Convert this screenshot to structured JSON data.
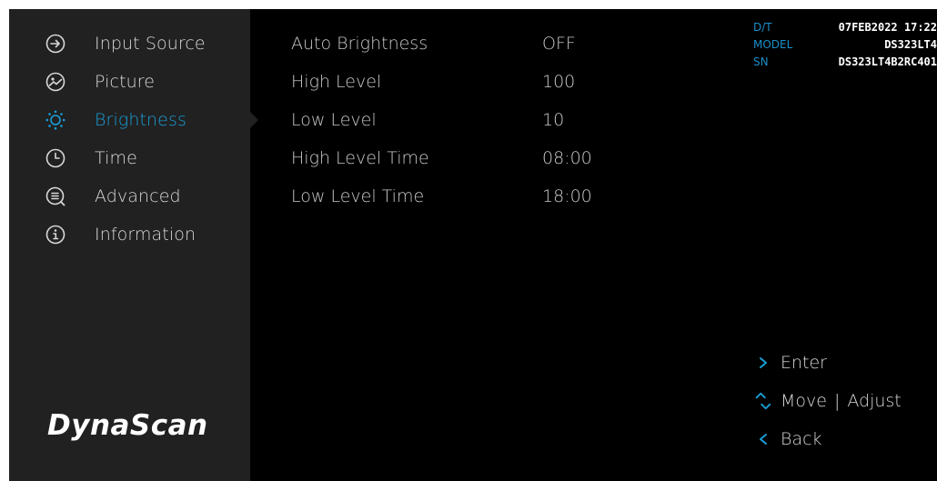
{
  "colors": {
    "accent": "#1a9fd8",
    "sidebar_bg": "#212121",
    "screen_bg": "#000000",
    "text": "#d8d8d8"
  },
  "sidebar": {
    "items": [
      {
        "label": "Input Source",
        "icon": "input-source-icon",
        "active": false
      },
      {
        "label": "Picture",
        "icon": "picture-icon",
        "active": false
      },
      {
        "label": "Brightness",
        "icon": "brightness-icon",
        "active": true
      },
      {
        "label": "Time",
        "icon": "clock-icon",
        "active": false
      },
      {
        "label": "Advanced",
        "icon": "advanced-icon",
        "active": false
      },
      {
        "label": "Information",
        "icon": "info-icon",
        "active": false
      }
    ],
    "logo": "DynaScan"
  },
  "settings": [
    {
      "label": "Auto Brightness",
      "value": "OFF"
    },
    {
      "label": "High Level",
      "value": "100"
    },
    {
      "label": "Low Level",
      "value": "10"
    },
    {
      "label": "High Level Time",
      "value": "08:00"
    },
    {
      "label": "Low Level Time",
      "value": "18:00"
    }
  ],
  "info": {
    "dt_label": "D/T",
    "dt_value": "07FEB2022 17:22",
    "model_label": "MODEL",
    "model_value": "DS323LT4",
    "sn_label": "SN",
    "sn_value": "DS323LT4B2RC401"
  },
  "hints": {
    "enter": "Enter",
    "move": "Move",
    "separator": "|",
    "adjust": "Adjust",
    "back": "Back"
  }
}
